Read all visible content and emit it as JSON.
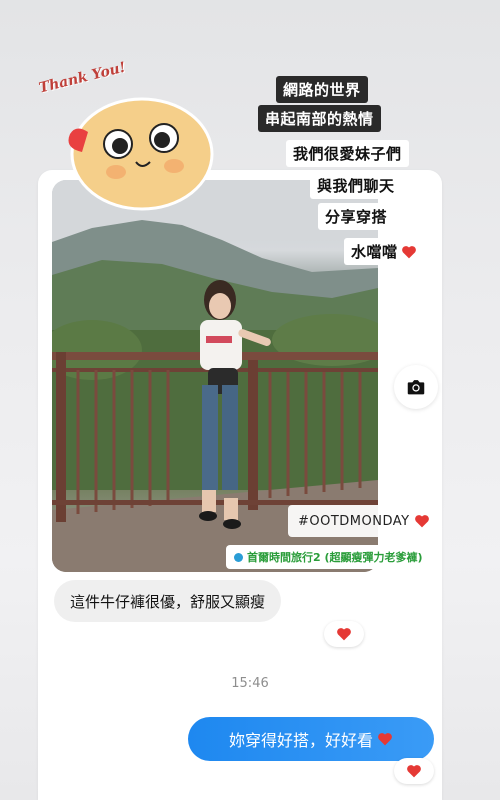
{
  "story_captions": {
    "line1": "網路的世界",
    "line2": "串起南部的熱情",
    "line3": "我們很愛妹子們",
    "line4": "與我們聊天",
    "line5": "分享穿搭",
    "line6": "水噹噹"
  },
  "sticker": {
    "text": "Thank You!",
    "icon": "smiley-face-icon"
  },
  "photo": {
    "hashtag": "#OOTDMONDAY",
    "product_link": "首爾時間旅行2 (超顯瘦彈力老爹褲)"
  },
  "messages": {
    "incoming": "這件牛仔褲很優，舒服又顯瘦",
    "timestamp": "15:46",
    "outgoing": "妳穿得好搭，好好看"
  },
  "colors": {
    "outgoing_bubble": "#1e88f0",
    "incoming_bubble": "#efefef",
    "heart": "#e53935",
    "link_green": "#2a9d3a"
  }
}
